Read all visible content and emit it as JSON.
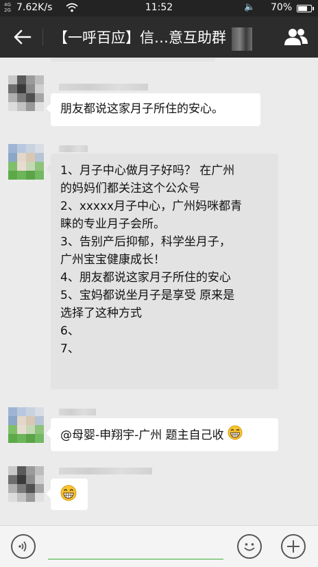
{
  "status_bar": {
    "network": "4G\n2G",
    "speed": "7.62K/s",
    "time": "11:52",
    "battery": "70%",
    "battery_level": 0.7
  },
  "header": {
    "title": "【一呼百应】信…意互助群"
  },
  "messages": [
    {
      "type": "text",
      "lines": [
        "朋友都说这家月子所住的安心。"
      ]
    },
    {
      "type": "text",
      "lines": [
        "1、月子中心做月子好吗？ 在广州",
        "的妈妈们都关注这个公众号",
        "2、xxxxx月子中心，广州妈咪都青",
        "睐的专业月子会所。",
        "3、告别产后抑郁，科学坐月子，",
        "广州宝宝健康成长！",
        "4、朋友都说这家月子所住的安心",
        "5、宝妈都说坐月子是享受 原来是",
        "选择了这种方式",
        "6、",
        "7、"
      ]
    },
    {
      "type": "text",
      "lines": [
        "@母婴-申翔宇-广州 题主自己收"
      ],
      "emoji": "grin-emoji"
    },
    {
      "type": "emoji",
      "emoji": "grin-emoji"
    }
  ],
  "colors": {
    "status_bar": "#232323",
    "title_bar": "#2c2c2c",
    "chat_bg": "#ebebeb",
    "bubble": "#ffffff",
    "accent": "#3cb034"
  },
  "icons": {
    "back": "back-arrow-icon",
    "group": "group-members-icon",
    "voice": "voice-icon",
    "emoji": "smiley-icon",
    "more": "plus-icon"
  }
}
